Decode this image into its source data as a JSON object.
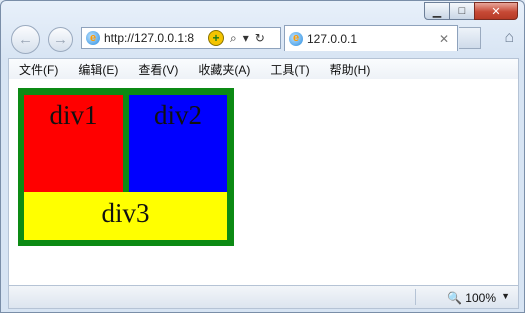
{
  "window": {
    "caption": {
      "minimize": "▁",
      "maximize": "□",
      "close": "✕"
    }
  },
  "nav": {
    "back_icon": "arrow-left-icon",
    "forward_icon": "arrow-right-icon",
    "back_glyph": "←",
    "forward_glyph": "→"
  },
  "address": {
    "url": "http://127.0.0.1:8",
    "ie_glyph": "e",
    "compat_glyph": "+",
    "search_glyph": "⌕",
    "dropdown_glyph": "▾",
    "refresh_glyph": "↻"
  },
  "tab": {
    "title": "127.0.0.1",
    "close_glyph": "✕"
  },
  "home_glyph": "⌂",
  "menu": {
    "items": [
      "文件(F)",
      "编辑(E)",
      "查看(V)",
      "收藏夹(A)",
      "工具(T)",
      "帮助(H)"
    ]
  },
  "page": {
    "div1": "div1",
    "div2": "div2",
    "div3": "div3"
  },
  "colors": {
    "outer_border": "#0c8a14",
    "div1": "#ff0000",
    "div2": "#0000ff",
    "div3": "#ffff00"
  },
  "status": {
    "zoom": "100%",
    "zoom_glyph": "🔍",
    "zoom_arrow": "▼"
  }
}
